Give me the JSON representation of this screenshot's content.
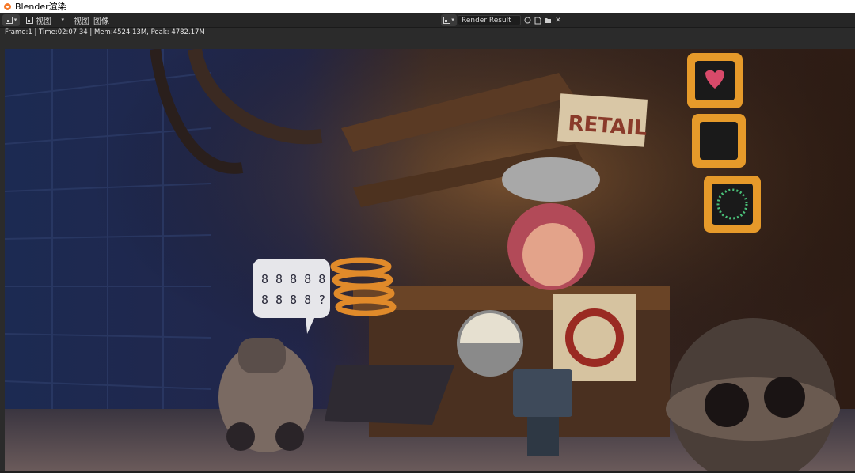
{
  "window": {
    "title": "Blender渲染"
  },
  "header": {
    "menu": [
      "视图",
      "视图",
      "图像"
    ],
    "image_name": "Render Result"
  },
  "status": {
    "text": "Frame:1 | Time:02:07.34 | Mem:4524.13M, Peak: 4782.17M"
  },
  "render": {
    "sign_text": "RETAIL",
    "bubble_line1": "8 8 8 8 8",
    "bubble_line2": "8 8 8 8 ?"
  },
  "icons": [
    "blender-icon",
    "image-editor-icon",
    "view-icon",
    "image-browse-icon",
    "fake-user-icon",
    "new-image-icon",
    "open-image-icon",
    "close-icon"
  ],
  "colors": {
    "header_bg": "#262626",
    "accent": "#f5792a",
    "sign": "#d9c7a6"
  }
}
